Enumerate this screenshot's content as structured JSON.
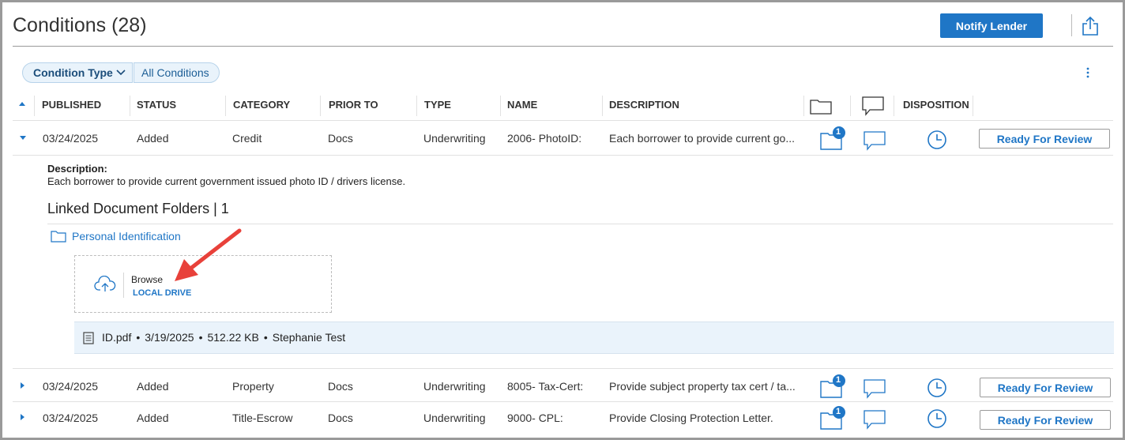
{
  "header": {
    "title": "Conditions (28)",
    "notify_label": "Notify Lender"
  },
  "filters": {
    "type_label": "Condition Type",
    "all_label": "All Conditions"
  },
  "columns": {
    "published": "PUBLISHED",
    "status": "STATUS",
    "category": "CATEGORY",
    "prior_to": "PRIOR TO",
    "type": "TYPE",
    "name": "NAME",
    "description": "DESCRIPTION",
    "disposition": "DISPOSITION"
  },
  "rows": [
    {
      "published": "03/24/2025",
      "status": "Added",
      "category": "Credit",
      "prior_to": "Docs",
      "type": "Underwriting",
      "name": "2006- PhotoID:",
      "description": "Each borrower to provide current go...",
      "doc_badge": "1",
      "disposition_label": "Ready For Review",
      "expanded": true
    },
    {
      "published": "03/24/2025",
      "status": "Added",
      "category": "Property",
      "prior_to": "Docs",
      "type": "Underwriting",
      "name": "8005- Tax-Cert:",
      "description": "Provide subject property tax cert / ta...",
      "doc_badge": "1",
      "disposition_label": "Ready For Review",
      "expanded": false
    },
    {
      "published": "03/24/2025",
      "status": "Added",
      "category": "Title-Escrow",
      "prior_to": "Docs",
      "type": "Underwriting",
      "name": "9000- CPL:",
      "description": "Provide Closing Protection Letter.",
      "doc_badge": "1",
      "disposition_label": "Ready For Review",
      "expanded": false
    }
  ],
  "detail": {
    "desc_label": "Description:",
    "desc_text": "Each borrower to provide current government issued photo ID / drivers license.",
    "linked_title": "Linked Document Folders | 1",
    "folder_name": "Personal Identification",
    "browse_label": "Browse",
    "local_drive_label": "LOCAL DRIVE",
    "file": {
      "name": "ID.pdf",
      "date": "3/19/2025",
      "size": "512.22 KB",
      "user": "Stephanie Test",
      "separator": "•"
    }
  },
  "colors": {
    "accent": "#1f76c6",
    "annotation_arrow": "#e8413a",
    "file_bar": "#eaf3fb"
  },
  "icons": [
    "share-icon",
    "chevron-down-icon",
    "kebab-menu-icon",
    "folder-icon",
    "comment-icon",
    "clock-icon",
    "cloud-upload-icon",
    "file-icon",
    "arrow-annotation"
  ]
}
